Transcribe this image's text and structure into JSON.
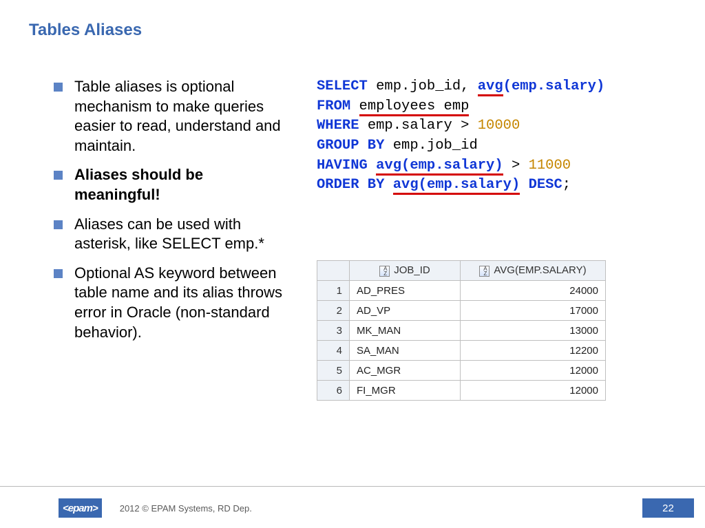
{
  "title": "Tables Aliases",
  "bullets": [
    {
      "text": "Table aliases is optional mechanism to make queries easier to read, understand and maintain.",
      "style": "blue"
    },
    {
      "text": "Aliases should be meaningful!",
      "style": "bold"
    },
    {
      "text": "Aliases can be used with asterisk, like SELECT emp.*",
      "style": "plain"
    },
    {
      "text": "Optional AS keyword between table name and its alias throws error in Oracle (non-standard behavior).",
      "style": "plain"
    }
  ],
  "sql": {
    "line1_kw": "SELECT",
    "line1_txt": " emp.job_id, ",
    "line1_avg": "avg",
    "line1_arg": "(emp.salary)",
    "line2_kw": "FROM",
    "line2_tbl": "employees emp",
    "line3_kw": "WHERE",
    "line3_txt": " emp.salary > ",
    "line3_num": "10000",
    "line4_kw": "GROUP BY",
    "line4_txt": " emp.job_id",
    "line5_kw": "HAVING",
    "line5_avg": "avg",
    "line5_arg": "(emp.salary)",
    "line5_gt": " > ",
    "line5_num": "11000",
    "line6_kw": "ORDER BY",
    "line6_avg": "avg",
    "line6_arg": "(emp.salary)",
    "line6_desc": "DESC",
    "line6_semi": ";"
  },
  "result": {
    "headers": {
      "job": "JOB_ID",
      "sal": "AVG(EMP.SALARY)"
    },
    "rows": [
      {
        "n": "1",
        "job": "AD_PRES",
        "sal": "24000"
      },
      {
        "n": "2",
        "job": "AD_VP",
        "sal": "17000"
      },
      {
        "n": "3",
        "job": "MK_MAN",
        "sal": "13000"
      },
      {
        "n": "4",
        "job": "SA_MAN",
        "sal": "12200"
      },
      {
        "n": "5",
        "job": "AC_MGR",
        "sal": "12000"
      },
      {
        "n": "6",
        "job": "FI_MGR",
        "sal": "12000"
      }
    ]
  },
  "footer": {
    "logo": "<epam>",
    "copyright": "2012 © EPAM Systems, RD Dep.",
    "page": "22"
  },
  "chart_data": {
    "type": "table",
    "title": "Result of avg(emp.salary) grouped by job_id",
    "columns": [
      "JOB_ID",
      "AVG(EMP.SALARY)"
    ],
    "rows": [
      [
        "AD_PRES",
        24000
      ],
      [
        "AD_VP",
        17000
      ],
      [
        "MK_MAN",
        13000
      ],
      [
        "SA_MAN",
        12200
      ],
      [
        "AC_MGR",
        12000
      ],
      [
        "FI_MGR",
        12000
      ]
    ]
  }
}
